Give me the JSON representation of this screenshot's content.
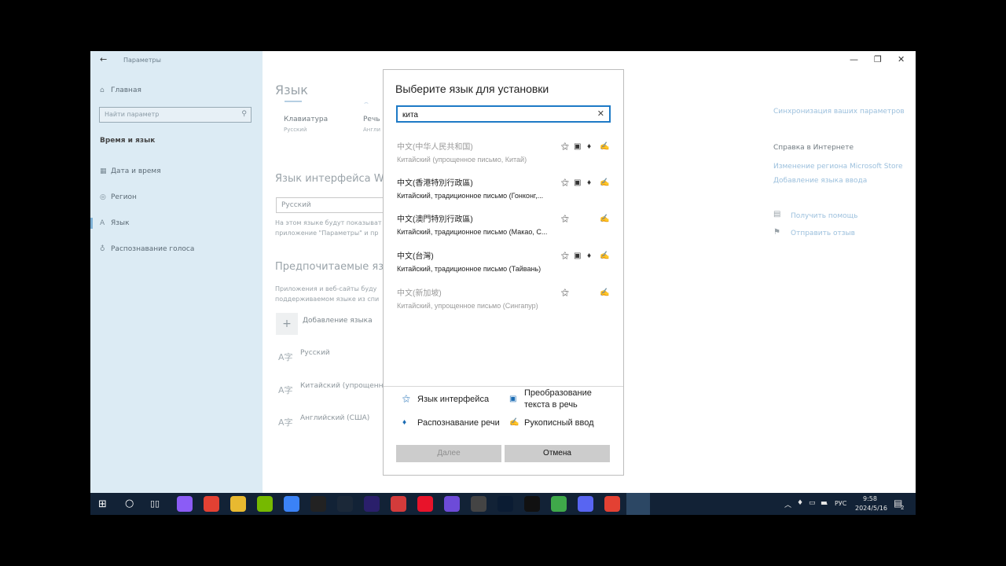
{
  "window": {
    "title": "Параметры",
    "home": "Главная",
    "search_placeholder": "Найти параметр",
    "section": "Время и язык",
    "nav": [
      {
        "label": "Дата и время",
        "icon": "calendar-icon"
      },
      {
        "label": "Регион",
        "icon": "globe-icon"
      },
      {
        "label": "Язык",
        "icon": "language-icon"
      },
      {
        "label": "Распознавание голоса",
        "icon": "microphone-icon"
      }
    ]
  },
  "main": {
    "title": "Язык",
    "tiles": [
      {
        "label": "Клавиатура",
        "value": "Русский"
      },
      {
        "label": "Речь",
        "value": "Англи"
      }
    ],
    "ui_lang_heading": "Язык интерфейса Wind",
    "ui_lang_value": "Русский",
    "ui_lang_note1": "На этом языке будут показыват",
    "ui_lang_note2": "приложение \"Параметры\" и пр",
    "pref_heading": "Предпочитаемые язык",
    "pref_note1": "Приложения и веб-сайты буду",
    "pref_note2": "поддерживаемом языке из спи",
    "add_label": "Добавление языка",
    "langs": [
      "Русский",
      "Китайский (упрощенное",
      "Английский (США)"
    ]
  },
  "right": {
    "sync": "Синхронизация ваших параметров",
    "help_heading": "Справка в Интернете",
    "link1": "Изменение региона Microsoft Store",
    "link2": "Добавление языка ввода",
    "get_help": "Получить помощь",
    "feedback": "Отправить отзыв"
  },
  "dialog": {
    "title": "Выберите язык для установки",
    "search_value": "кита",
    "results": [
      {
        "name": "中文(中华人民共和国)",
        "desc": "Китайский (упрощенное письмо, Китай)",
        "features": [
          "interface",
          "speech",
          "voice",
          "handwriting"
        ]
      },
      {
        "name": "中文(香港特別行政區)",
        "desc": "Китайский, традиционное письмо (Гонконг,...",
        "features": [
          "interface",
          "speech",
          "voice",
          "handwriting"
        ]
      },
      {
        "name": "中文(澳門特別行政區)",
        "desc": "Китайский, традиционное письмо (Макао, С...",
        "features": [
          "interface",
          "handwriting"
        ]
      },
      {
        "name": "中文(台灣)",
        "desc": "Китайский, традиционное письмо (Тайвань)",
        "features": [
          "interface",
          "speech",
          "voice",
          "handwriting"
        ]
      },
      {
        "name": "中文(新加坡)",
        "desc": "Китайский, упрощенное письмо (Сингапур)",
        "features": [
          "interface",
          "handwriting"
        ]
      }
    ],
    "legend": {
      "interface": "Язык интерфейса",
      "tts1": "Преобразование",
      "tts2": "текста в речь",
      "speech": "Распознавание речи",
      "handwriting": "Рукописный ввод"
    },
    "next": "Далее",
    "cancel": "Отмена"
  },
  "taskbar": {
    "lang": "РУС",
    "time": "9:58",
    "date": "2024/5/16",
    "notif_count": "2",
    "apps": [
      {
        "name": "assistant",
        "color": "#8b5cf6"
      },
      {
        "name": "chrome",
        "color": "#e34133"
      },
      {
        "name": "explorer",
        "color": "#e8b930"
      },
      {
        "name": "nvidia",
        "color": "#76b900"
      },
      {
        "name": "chat",
        "color": "#3b82f6"
      },
      {
        "name": "recorder",
        "color": "#222222"
      },
      {
        "name": "steam",
        "color": "#1b2838"
      },
      {
        "name": "audition",
        "color": "#2a1f6b"
      },
      {
        "name": "app",
        "color": "#d33b3b"
      },
      {
        "name": "opera",
        "color": "#e8132a"
      },
      {
        "name": "vpn",
        "color": "#6d4bd8"
      },
      {
        "name": "davinci",
        "color": "#444444"
      },
      {
        "name": "photoshop",
        "color": "#0b1c33"
      },
      {
        "name": "tiktok",
        "color": "#111111"
      },
      {
        "name": "bluestacks",
        "color": "#3fa84a"
      },
      {
        "name": "discord",
        "color": "#5865f2"
      },
      {
        "name": "chrome2",
        "color": "#e34133"
      },
      {
        "name": "settings",
        "color": "#2c4764"
      }
    ]
  }
}
